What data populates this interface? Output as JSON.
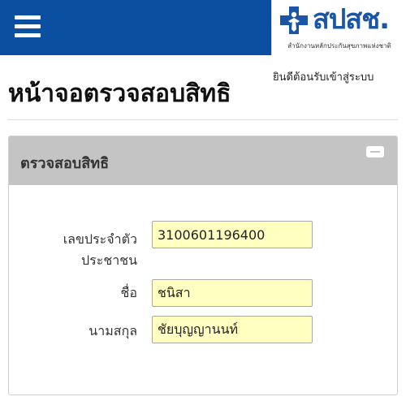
{
  "header": {
    "logo_text": "สปสช.",
    "logo_subtitle": "สำนักงานหลักประกันสุขภาพแห่งชาติ",
    "brand_color": "#0a4fa0"
  },
  "page": {
    "welcome_text": "ยินดีต้อนรับเข้าสู่ระบบ",
    "title": "หน้าจอตรวจสอบสิทธิ"
  },
  "panel": {
    "title": "ตรวจสอบสิทธิ",
    "fields": [
      {
        "label_line1": "เลขประจำตัว",
        "label_line2": "ประชาชน",
        "value": "3100601196400"
      },
      {
        "label": "ชื่อ",
        "value": "ชนิสา"
      },
      {
        "label": "นามสกุล",
        "value": "ชัยบุญญานนท์"
      }
    ],
    "field_bg_color": "#ffffc0"
  },
  "icons": {
    "menu": "hamburger-icon",
    "collapse": "minus-icon",
    "logo": "nhso-cross-logo-icon"
  }
}
